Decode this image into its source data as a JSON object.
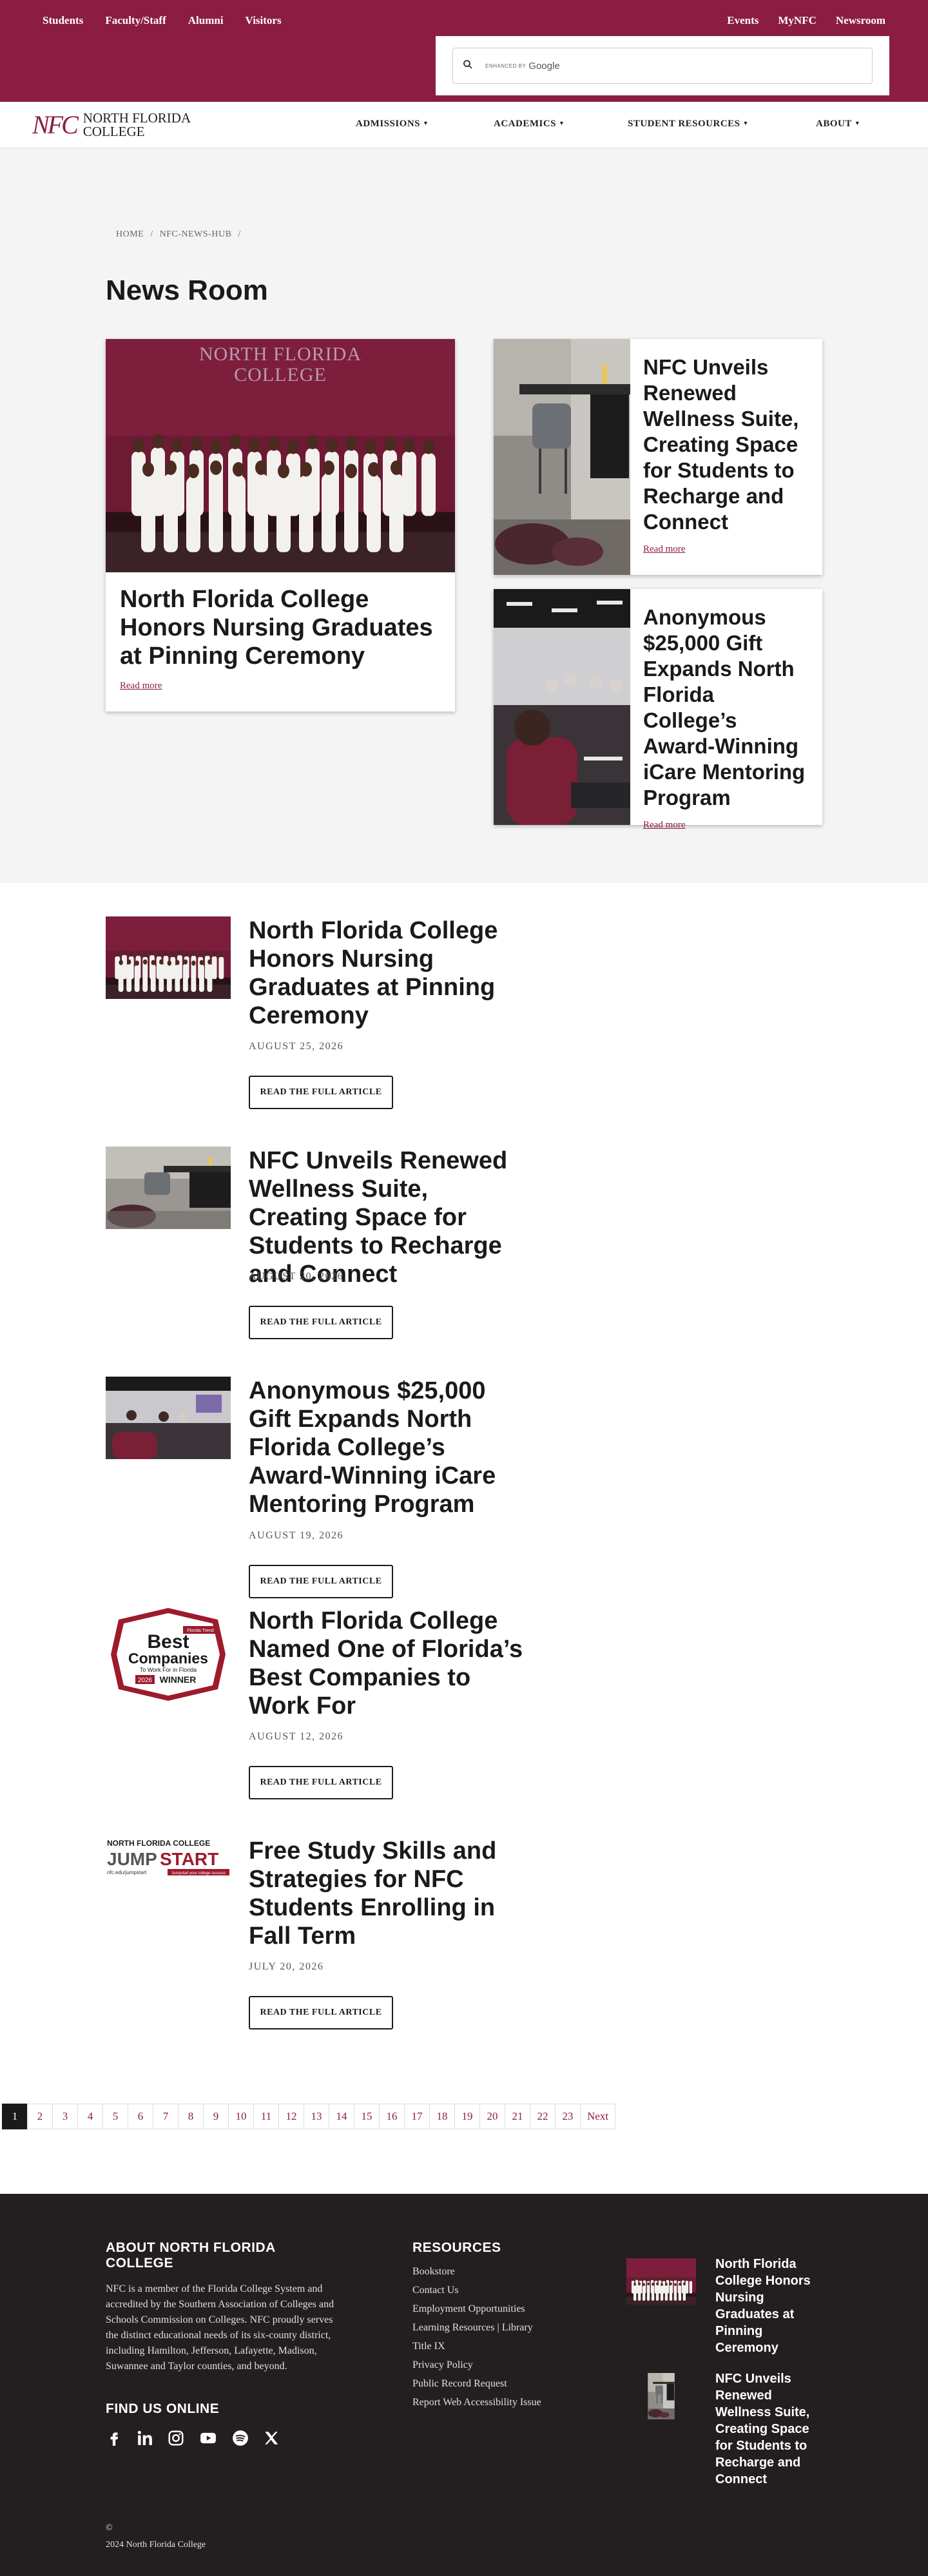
{
  "topbar": {
    "left_links": [
      "Students",
      "Faculty/Staff",
      "Alumni",
      "Visitors"
    ],
    "right_links": [
      "Events",
      "MyNFC",
      "Newsroom"
    ],
    "search": {
      "enhanced_label": "ENHANCED BY",
      "brand": "Google"
    }
  },
  "logo": {
    "mark": "NFC",
    "line1": "NORTH FLORIDA",
    "line2": "COLLEGE"
  },
  "mainnav": {
    "items": [
      "ADMISSIONS",
      "ACADEMICS",
      "STUDENT RESOURCES",
      "ABOUT"
    ]
  },
  "breadcrumb": {
    "home": "HOME",
    "sep": "/",
    "hub": "NFC-NEWS-HUB"
  },
  "page_title": "News Room",
  "featured": {
    "main": {
      "title": "North Florida College Honors Nursing Graduates at Pinning Ceremony",
      "read_more": "Read more",
      "banner": "NORTH FLORIDA COLLEGE"
    },
    "side": [
      {
        "title": "NFC Unveils Renewed Wellness Suite, Creating Space for Students to Recharge and Connect",
        "read_more": "Read more"
      },
      {
        "title": "Anonymous $25,000 Gift Expands North Florida College’s Award-Winning iCare Mentoring Program",
        "read_more": "Read more"
      }
    ]
  },
  "news": [
    {
      "title": "North Florida College Honors Nursing Graduates at Pinning Ceremony",
      "date": "AUGUST 25, 2026",
      "button": "READ THE FULL ARTICLE"
    },
    {
      "title": "NFC Unveils Renewed Wellness Suite, Creating Space for Students to Recharge and Connect",
      "date": "AUGUST 20, 2026",
      "button": "READ THE FULL ARTICLE"
    },
    {
      "title": "Anonymous $25,000 Gift Expands North Florida College’s Award-Winning iCare Mentoring Program",
      "date": "AUGUST 19, 2026",
      "button": "READ THE FULL ARTICLE"
    },
    {
      "title": "North Florida College Named One of Florida’s Best Companies to Work For",
      "date": "AUGUST 12, 2026",
      "button": "READ THE FULL ARTICLE"
    },
    {
      "title": "Free Study Skills and Strategies for NFC Students Enrolling in Fall Term",
      "date": "JULY 20, 2026",
      "button": "READ THE FULL ARTICLE"
    }
  ],
  "badge": {
    "florida_trend": "Florida Trend",
    "best": "Best",
    "companies": "Companies",
    "to_work": "To Work For in Florida",
    "year": "2026",
    "winner": "WINNER"
  },
  "jumpstart": {
    "top": "NORTH FLORIDA COLLEGE",
    "jump": "JUMP",
    "start": "START",
    "url": "nfc.edu/jumpstart",
    "tag": "Jumpstart your college success"
  },
  "pagination": {
    "pages": [
      "1",
      "2",
      "3",
      "4",
      "5",
      "6",
      "7",
      "8",
      "9",
      "10",
      "11",
      "12",
      "13",
      "14",
      "15",
      "16",
      "17",
      "18",
      "19",
      "20",
      "21",
      "22",
      "23"
    ],
    "next": "Next",
    "current": "1"
  },
  "footer": {
    "about_heading": "ABOUT NORTH FLORIDA COLLEGE",
    "about_text": "NFC is a member of the Florida College System and accredited by the Southern Association of Colleges and Schools Commission on Colleges. NFC proudly serves the distinct educational needs of its six-county district, including Hamilton, Jefferson, Lafayette, Madison, Suwannee and Taylor counties, and beyond.",
    "find_heading": "FIND US ONLINE",
    "social_icons": [
      "facebook-icon",
      "linkedin-icon",
      "instagram-icon",
      "youtube-icon",
      "spotify-icon",
      "x-icon"
    ],
    "resources_heading": "RESOURCES",
    "resources": [
      "Bookstore",
      "Contact Us",
      "Employment Opportunities",
      "Learning Resources | Library",
      "Title IX",
      "Privacy Policy",
      "Public Record Request",
      "Report Web Accessibility Issue"
    ],
    "recent": [
      {
        "title": "North Florida College Honors Nursing Graduates at Pinning Ceremony"
      },
      {
        "title": "NFC Unveils Renewed Wellness Suite, Creating Space for Students to Recharge and Connect"
      }
    ],
    "copyright_symbol": "©",
    "copyright_text": "2024 North Florida College"
  },
  "colors": {
    "brand": "#8b1d42",
    "footer_bg": "#231f20",
    "hero_bg": "#f4f4f4"
  }
}
